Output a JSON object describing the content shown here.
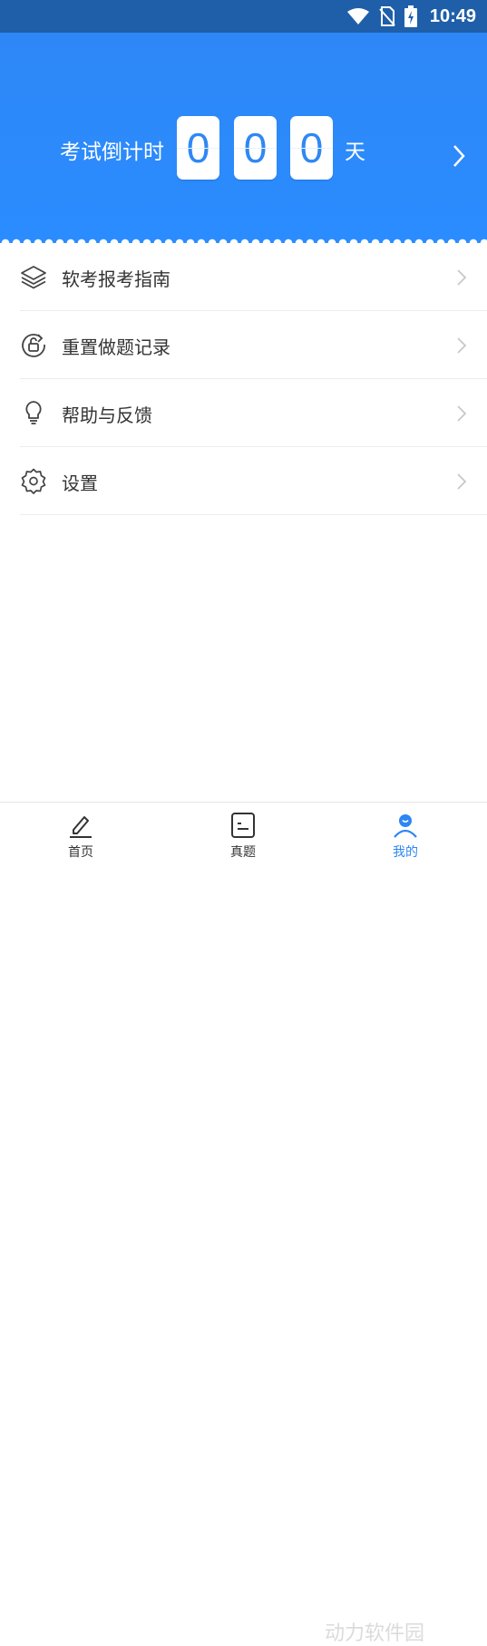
{
  "status_bar": {
    "time": "10:49"
  },
  "countdown": {
    "label": "考试倒计时",
    "digits": [
      "0",
      "0",
      "0"
    ],
    "unit": "天"
  },
  "menu": {
    "items": [
      {
        "label": "软考报考指南",
        "icon": "layers-icon"
      },
      {
        "label": "重置做题记录",
        "icon": "reset-icon"
      },
      {
        "label": "帮助与反馈",
        "icon": "lightbulb-icon"
      },
      {
        "label": "设置",
        "icon": "gear-icon"
      }
    ]
  },
  "tabbar": {
    "tabs": [
      {
        "label": "首页",
        "icon": "pen-icon"
      },
      {
        "label": "真题",
        "icon": "exam-icon"
      },
      {
        "label": "我的",
        "icon": "user-icon",
        "active": true
      }
    ]
  },
  "watermark": "动力软件园",
  "colors": {
    "primary": "#2a8cff",
    "statusbar": "#1f5fa9",
    "active": "#2d86f3"
  }
}
